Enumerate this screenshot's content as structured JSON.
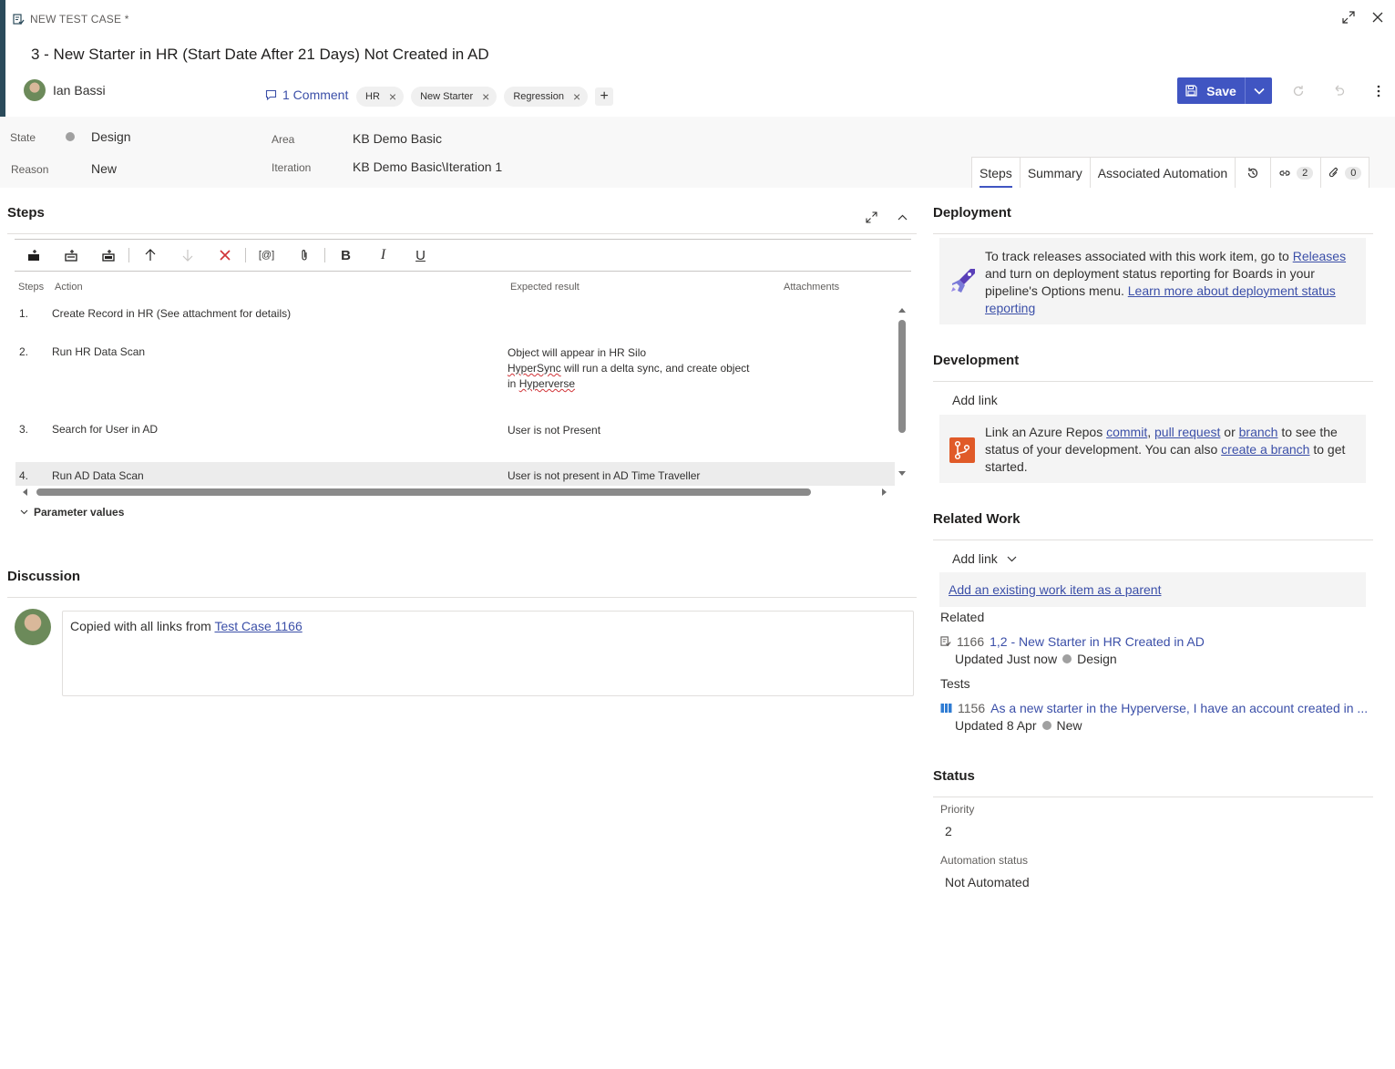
{
  "header": {
    "work_item_type": "NEW TEST CASE *",
    "title": "3 - New Starter in HR (Start Date After 21 Days) Not Created in AD",
    "assignee": "Ian Bassi",
    "comments_label": "1 Comment",
    "tags": [
      "HR",
      "New Starter",
      "Regression"
    ],
    "save_label": "Save",
    "accent_color": "#4055c2"
  },
  "fields": {
    "state_label": "State",
    "state_value": "Design",
    "reason_label": "Reason",
    "reason_value": "New",
    "area_label": "Area",
    "area_value": "KB Demo Basic",
    "iteration_label": "Iteration",
    "iteration_value": "KB Demo Basic\\Iteration 1"
  },
  "tabs": {
    "steps": "Steps",
    "summary": "Summary",
    "automation": "Associated Automation",
    "links_count": "2",
    "attachments_count": "0"
  },
  "steps": {
    "title": "Steps",
    "col_steps": "Steps",
    "col_action": "Action",
    "col_expected": "Expected result",
    "col_attachments": "Attachments",
    "rows": [
      {
        "num": "1.",
        "action": "Create Record in HR (See attachment for details)",
        "expected": [
          "",
          "",
          ""
        ]
      },
      {
        "num": "2.",
        "action": "Run HR Data Scan",
        "expected": [
          "Object will appear in HR Silo",
          "will run a delta sync, and create object",
          "in "
        ]
      },
      {
        "num": "3.",
        "action": "Search for User in AD",
        "expected": [
          "User is not Present",
          "",
          ""
        ]
      },
      {
        "num": "4.",
        "action": "Run AD Data Scan",
        "expected": [
          "User is not present in AD Time Traveller",
          "",
          ""
        ]
      }
    ],
    "hypersync_word": "HyperSync",
    "hyperverse_word": "Hyperverse",
    "parameter_values": "Parameter values"
  },
  "discussion": {
    "title": "Discussion",
    "comment_prefix": "Copied with all links from ",
    "comment_link": "Test Case 1166"
  },
  "deployment": {
    "title": "Deployment",
    "text_1": "To track releases associated with this work item, go to ",
    "link_releases": "Releases",
    "text_2": " and turn on deployment status reporting for Boards in your pipeline's Options menu. ",
    "link_learn": "Learn more about deployment status reporting"
  },
  "development": {
    "title": "Development",
    "add_link": "Add link",
    "text_1": "Link an Azure Repos ",
    "link_commit": "commit",
    "sep_1": ", ",
    "link_pr": "pull request",
    "sep_2": " or ",
    "link_branch": "branch",
    "text_2": " to see the status of your development. You can also ",
    "link_create_branch": "create a branch",
    "text_3": " to get started."
  },
  "related_work": {
    "title": "Related Work",
    "add_link": "Add link",
    "add_parent": "Add an existing work item as a parent",
    "related_label": "Related",
    "related_item": {
      "id": "1166",
      "title": "1,2 - New Starter in HR Created in AD",
      "updated": "Updated Just now",
      "state": "Design"
    },
    "tests_label": "Tests",
    "test_item": {
      "id": "1156",
      "title": "As a new starter in the Hyperverse, I have an account created in ...",
      "updated": "Updated 8 Apr",
      "state": "New"
    }
  },
  "status": {
    "title": "Status",
    "priority_label": "Priority",
    "priority_value": "2",
    "automation_label": "Automation status",
    "automation_value": "Not Automated"
  }
}
